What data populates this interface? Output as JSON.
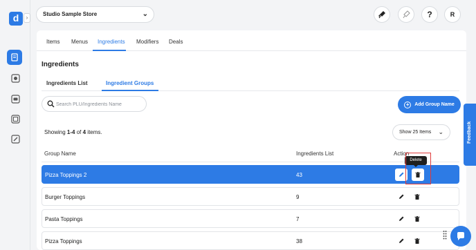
{
  "app": {
    "logo_letter": "d"
  },
  "header": {
    "store_selector": "Studio Sample Store",
    "avatar_initial": "R",
    "help_label": "?"
  },
  "tabs": [
    {
      "label": "Items"
    },
    {
      "label": "Menus"
    },
    {
      "label": "Ingredients",
      "active": true
    },
    {
      "label": "Modifiers"
    },
    {
      "label": "Deals"
    }
  ],
  "page_title": "Ingredients",
  "subtabs": [
    {
      "label": "Ingredients List"
    },
    {
      "label": "Ingredient Groups",
      "active": true
    }
  ],
  "search": {
    "placeholder": "Search PLU/Ingredients Name"
  },
  "add_button_label": "Add Group Name",
  "showing": {
    "prefix": "Showing ",
    "range": "1-4",
    "of": " of ",
    "total": "4",
    "suffix": " items."
  },
  "per_page": "Show 25 Items",
  "table": {
    "headers": {
      "name": "Group Name",
      "count": "Ingredients List",
      "action": "Action"
    },
    "rows": [
      {
        "name": "Pizza Toppings 2",
        "count": "43",
        "selected": true
      },
      {
        "name": "Burger Toppings",
        "count": "9"
      },
      {
        "name": "Pasta Toppings",
        "count": "7"
      },
      {
        "name": "Pizza Toppings",
        "count": "38"
      }
    ]
  },
  "tooltip": "Delete",
  "feedback_label": "Feedback",
  "colors": {
    "accent": "#2d7be5",
    "highlight": "#e03b3b"
  }
}
